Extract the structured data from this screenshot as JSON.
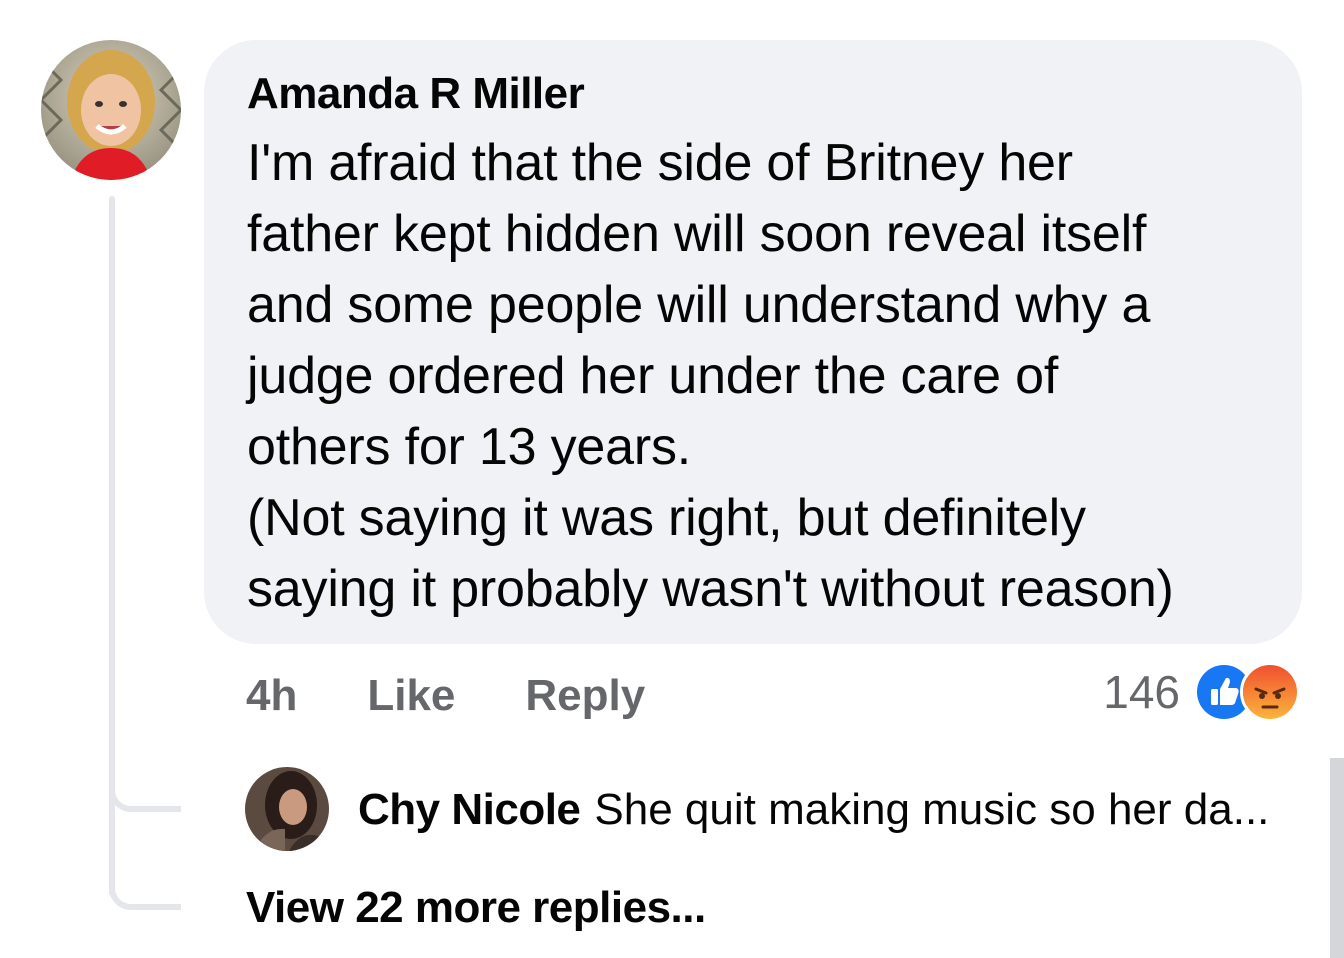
{
  "comment": {
    "author": "Amanda R Miller",
    "text": "I'm afraid that the side of Britney her\nfather kept hidden will soon reveal itself\nand some people will understand why a\njudge ordered her under the care of\nothers for 13 years.\n(Not saying it was right, but definitely\nsaying it probably wasn't without reason)",
    "time": "4h",
    "like_label": "Like",
    "reply_label": "Reply",
    "reaction_count": "146",
    "reactions": [
      "like-icon",
      "angry-icon"
    ]
  },
  "reply_preview": {
    "author": "Chy Nicole",
    "text": "She quit making music so her da..."
  },
  "view_more_label": "View 22 more replies...",
  "colors": {
    "bubble_bg": "#f0f2f5",
    "text_primary": "#050505",
    "text_secondary": "#65676b",
    "like_blue": "#1877f2",
    "angry_orange": "#f7714c",
    "thread_line": "#e4e6eb"
  }
}
